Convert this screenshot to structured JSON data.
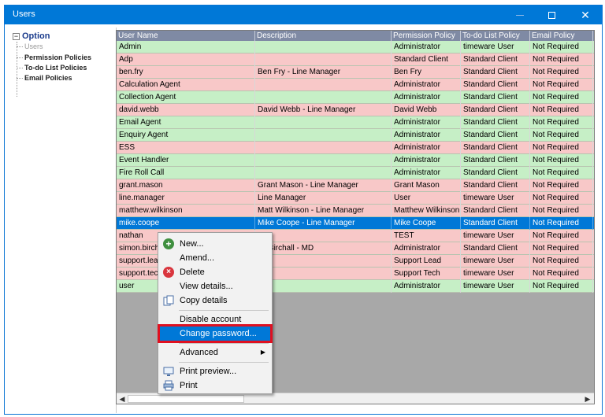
{
  "window": {
    "title": "Users",
    "minimize_glyph": "—",
    "maximize_glyph": "☐",
    "close_glyph": "✕"
  },
  "tree": {
    "root": "Option",
    "expander": "−",
    "items": [
      "Users",
      "Permission Policies",
      "To-do List Policies",
      "Email Policies"
    ],
    "selected": "Users"
  },
  "grid": {
    "columns": [
      "User Name",
      "Description",
      "Permission Policy",
      "To-do List Policy",
      "Email Policy"
    ],
    "rows": [
      {
        "name": "Admin",
        "description": "",
        "permission": "Administrator",
        "todo": "timeware User",
        "email": "Not Required",
        "color": "green"
      },
      {
        "name": "Adp",
        "description": "",
        "permission": "Standard Client",
        "todo": "Standard Client",
        "email": "Not Required",
        "color": "pink"
      },
      {
        "name": "ben.fry",
        "description": "Ben Fry - Line Manager",
        "permission": "Ben Fry",
        "todo": "Standard Client",
        "email": "Not Required",
        "color": "pink"
      },
      {
        "name": "Calculation Agent",
        "description": "",
        "permission": "Administrator",
        "todo": "Standard Client",
        "email": "Not Required",
        "color": "pink"
      },
      {
        "name": "Collection Agent",
        "description": "",
        "permission": "Administrator",
        "todo": "Standard Client",
        "email": "Not Required",
        "color": "green"
      },
      {
        "name": "david.webb",
        "description": "David Webb - Line Manager",
        "permission": "David Webb",
        "todo": "Standard Client",
        "email": "Not Required",
        "color": "pink"
      },
      {
        "name": "Email Agent",
        "description": "",
        "permission": "Administrator",
        "todo": "Standard Client",
        "email": "Not Required",
        "color": "green"
      },
      {
        "name": "Enquiry Agent",
        "description": "",
        "permission": "Administrator",
        "todo": "Standard Client",
        "email": "Not Required",
        "color": "green"
      },
      {
        "name": "ESS",
        "description": "",
        "permission": "Administrator",
        "todo": "Standard Client",
        "email": "Not Required",
        "color": "pink"
      },
      {
        "name": "Event Handler",
        "description": "",
        "permission": "Administrator",
        "todo": "Standard Client",
        "email": "Not Required",
        "color": "green"
      },
      {
        "name": "Fire Roll Call",
        "description": "",
        "permission": "Administrator",
        "todo": "Standard Client",
        "email": "Not Required",
        "color": "green"
      },
      {
        "name": "grant.mason",
        "description": "Grant Mason - Line Manager",
        "permission": "Grant Mason",
        "todo": "Standard Client",
        "email": "Not Required",
        "color": "pink"
      },
      {
        "name": "line.manager",
        "description": "Line Manager",
        "permission": "User",
        "todo": "timeware User",
        "email": "Not Required",
        "color": "pink"
      },
      {
        "name": "matthew.wilkinson",
        "description": "Matt Wilkinson - Line Manager",
        "permission": "Matthew Wilkinson",
        "todo": "Standard Client",
        "email": "Not Required",
        "color": "pink"
      },
      {
        "name": "mike.coope",
        "description": "Mike Coope - Line Manager",
        "permission": "Mike Coope",
        "todo": "Standard Client",
        "email": "Not Required",
        "color": "selected"
      },
      {
        "name": "nathan",
        "description": "",
        "permission": "TEST",
        "todo": "timeware User",
        "email": "Not Required",
        "color": "pink"
      },
      {
        "name": "simon.bircha",
        "description": "on Birchall - MD",
        "permission": "Administrator",
        "todo": "Standard Client",
        "email": "Not Required",
        "color": "pink"
      },
      {
        "name": "support.lead",
        "description": "",
        "permission": "Support Lead",
        "todo": "timeware User",
        "email": "Not Required",
        "color": "pink"
      },
      {
        "name": "support.tech",
        "description": "",
        "permission": "Support Tech",
        "todo": "timeware User",
        "email": "Not Required",
        "color": "pink"
      },
      {
        "name": "user",
        "description": "er",
        "permission": "Administrator",
        "todo": "timeware User",
        "email": "Not Required",
        "color": "green"
      }
    ],
    "scroll_left_glyph": "◀",
    "scroll_right_glyph": "▶"
  },
  "context_menu": {
    "items": [
      {
        "label": "New...",
        "icon": "add-icon"
      },
      {
        "label": "Amend...",
        "icon": ""
      },
      {
        "label": "Delete",
        "icon": "delete-icon"
      },
      {
        "label": "View details...",
        "icon": ""
      },
      {
        "label": "Copy details",
        "icon": "copy-icon"
      },
      {
        "label": "Disable account",
        "icon": ""
      },
      {
        "label": "Change password...",
        "icon": "",
        "highlighted": true
      },
      {
        "label": "Advanced",
        "icon": "",
        "submenu": true
      },
      {
        "label": "Print preview...",
        "icon": "print-preview-icon"
      },
      {
        "label": "Print",
        "icon": "printer-icon"
      }
    ],
    "submenu_glyph": "▶"
  },
  "colors": {
    "titlebar": "#0078d7",
    "row_green": "#c6efc6",
    "row_pink": "#f8c8c8",
    "selected": "#0078d7",
    "highlight_outline": "#e01020",
    "header": "#7f8aa4"
  }
}
